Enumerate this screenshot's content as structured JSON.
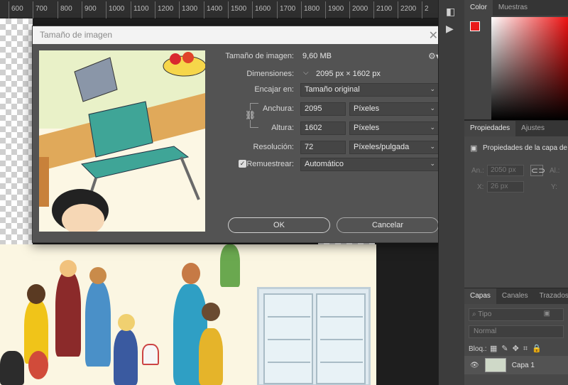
{
  "ruler": {
    "ticks": [
      "600",
      "700",
      "800",
      "900",
      "1000",
      "1100",
      "1200",
      "1300",
      "1400",
      "1500",
      "1600",
      "1700",
      "1800",
      "1900",
      "2000",
      "2100",
      "2200",
      "2"
    ]
  },
  "dialog": {
    "title": "Tamaño de imagen",
    "image_size_label": "Tamaño de imagen:",
    "image_size_value": "9,60 MB",
    "dimensions_label": "Dimensiones:",
    "dimensions_value": "2095 px × 1602 px",
    "fit_label": "Encajar en:",
    "fit_value": "Tamaño original",
    "width_label": "Anchura:",
    "width_value": "2095",
    "width_unit": "Píxeles",
    "height_label": "Altura:",
    "height_value": "1602",
    "height_unit": "Píxeles",
    "resolution_label": "Resolución:",
    "resolution_value": "72",
    "resolution_unit": "Píxeles/pulgada",
    "resample_label": "Remuestrear:",
    "resample_checked": true,
    "resample_value": "Automático",
    "ok_label": "OK",
    "cancel_label": "Cancelar"
  },
  "color_panel": {
    "tabs": [
      "Color",
      "Muestras"
    ],
    "fg_color": "#e81a1a"
  },
  "properties_panel": {
    "tabs": [
      "Propiedades",
      "Ajustes"
    ],
    "title": "Propiedades de la capa de",
    "an_label": "An.:",
    "an_value": "2050 px",
    "al_label": "Al.:",
    "x_label": "X:",
    "x_value": "26 px",
    "y_label": "Y:"
  },
  "layers_panel": {
    "tabs": [
      "Capas",
      "Canales",
      "Trazados"
    ],
    "search_placeholder": "Tipo",
    "blend_mode": "Normal",
    "lock_label": "Bloq.:",
    "layer_name": "Capa 1"
  }
}
